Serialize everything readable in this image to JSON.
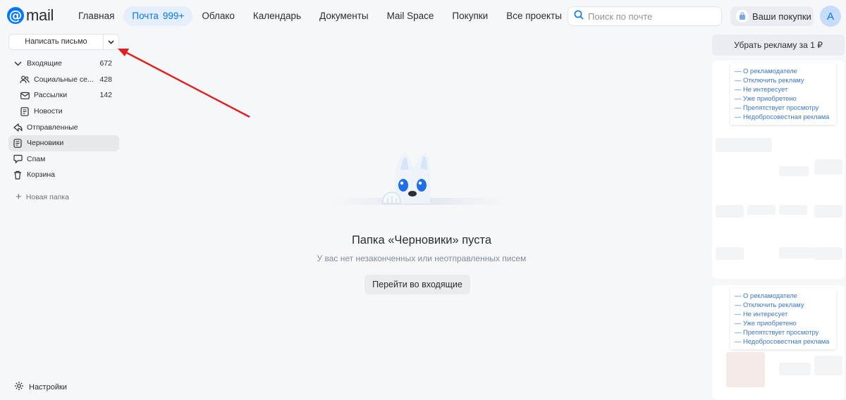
{
  "logo": {
    "text": "mail",
    "symbol": "@"
  },
  "nav": {
    "items": [
      {
        "label": "Главная"
      },
      {
        "label": "Почта",
        "badge": "999+"
      },
      {
        "label": "Облако"
      },
      {
        "label": "Календарь"
      },
      {
        "label": "Документы"
      },
      {
        "label": "Mail Space"
      },
      {
        "label": "Покупки"
      },
      {
        "label": "Все проекты"
      }
    ]
  },
  "search": {
    "placeholder": "Поиск по почте"
  },
  "purchases": {
    "label": "Ваши покупки"
  },
  "avatar": {
    "letter": "А"
  },
  "compose": {
    "label": "Написать письмо"
  },
  "folders": [
    {
      "label": "Входящие",
      "count": "672"
    },
    {
      "label": "Социальные се...",
      "count": "428"
    },
    {
      "label": "Рассылки",
      "count": "142"
    },
    {
      "label": "Новости",
      "count": ""
    },
    {
      "label": "Отправленные",
      "count": ""
    },
    {
      "label": "Черновики",
      "count": ""
    },
    {
      "label": "Спам",
      "count": ""
    },
    {
      "label": "Корзина",
      "count": ""
    }
  ],
  "new_folder": {
    "label": "Новая папка"
  },
  "settings": {
    "label": "Настройки"
  },
  "empty": {
    "title": "Папка «Черновики» пуста",
    "subtitle": "У вас нет незаконченных или неотправленных писем",
    "button": "Перейти во входящие"
  },
  "ads": {
    "remove_label": "Убрать рекламу за 1 ₽",
    "menu": [
      "— О рекламодателе",
      "— Отключить рекламу",
      "— Не интересует",
      "— Уже приобретено",
      "— Препятствует просмотру",
      "— Недобросовестная реклама"
    ]
  },
  "colors": {
    "accent": "#0077ff",
    "arrow": "#e02020",
    "background": "#f6f7f8"
  }
}
